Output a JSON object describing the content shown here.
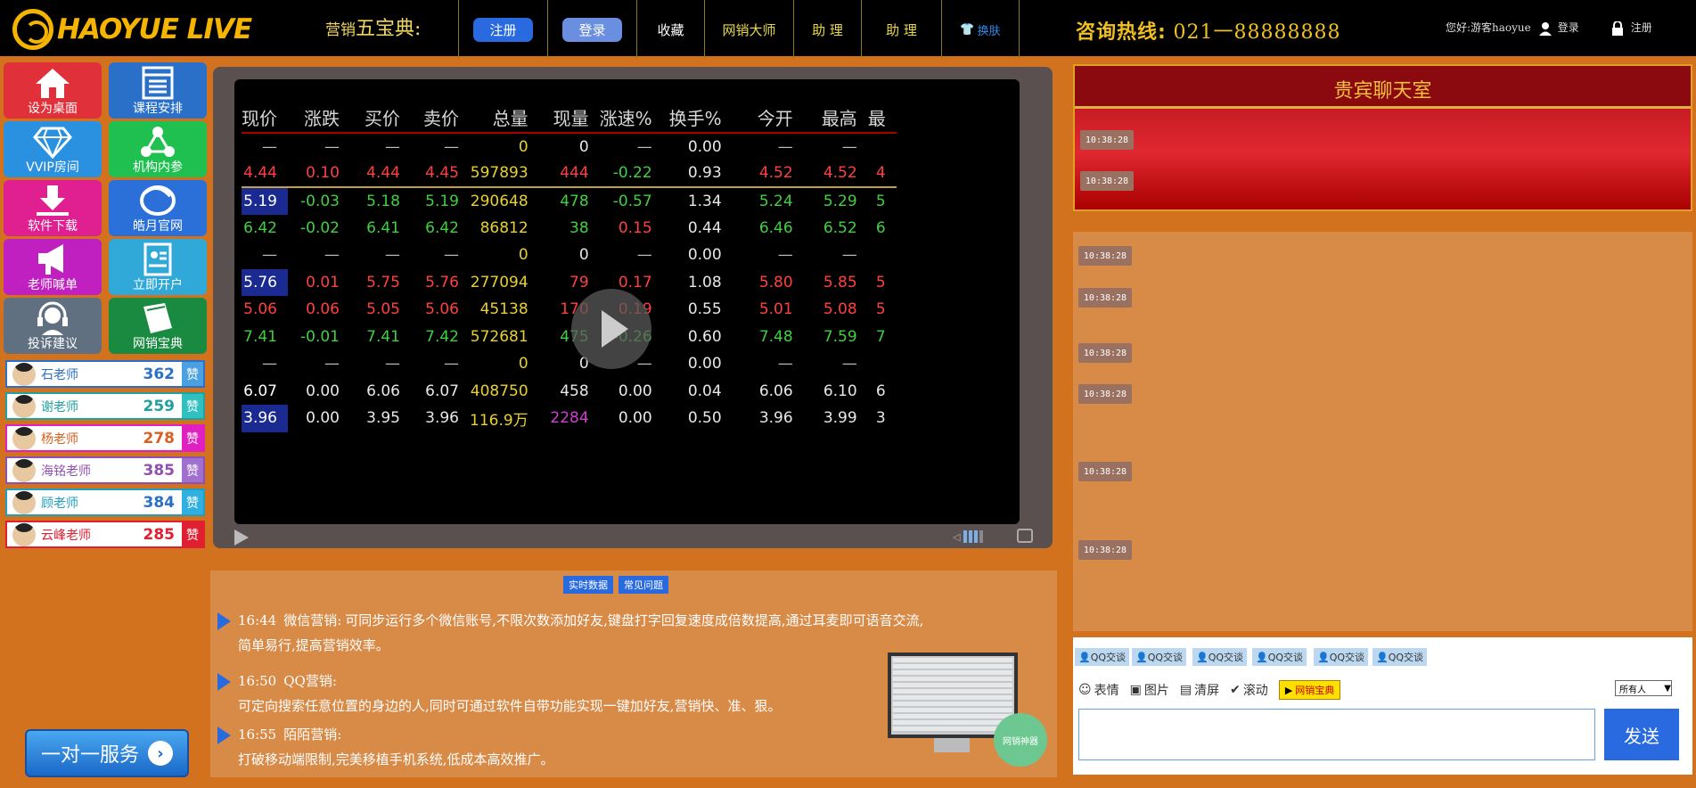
{
  "header": {
    "logo": "HAOYUE LIVE",
    "slogan_prefix": "营销",
    "slogan_main": "五宝典:",
    "register_btn": "注册",
    "login_btn": "登录",
    "nav": [
      "收藏",
      "网销大师",
      "助 理",
      "助 理",
      "换肤"
    ],
    "hotline_label": "咨询热线:",
    "hotline_number": "021一88888888",
    "greeting": "您好:游客haoyue",
    "user_login": "登录",
    "user_register": "注册"
  },
  "tiles": [
    {
      "label": "设为桌面",
      "icon": "home-icon",
      "color": "#e0303a"
    },
    {
      "label": "课程安排",
      "icon": "calendar-icon",
      "color": "#2a70c8"
    },
    {
      "label": "VVIP房间",
      "icon": "diamond-icon",
      "color": "#2a90e0"
    },
    {
      "label": "机构内参",
      "icon": "share-icon",
      "color": "#20c050"
    },
    {
      "label": "软件下载",
      "icon": "download-icon",
      "color": "#e02090"
    },
    {
      "label": "皓月官网",
      "icon": "logo-icon",
      "color": "#2a70d8"
    },
    {
      "label": "老师喊单",
      "icon": "megaphone-icon",
      "color": "#c020c0"
    },
    {
      "label": "立即开户",
      "icon": "id-card-icon",
      "color": "#30a8d8"
    },
    {
      "label": "投诉建议",
      "icon": "headset-icon",
      "color": "#607080"
    },
    {
      "label": "网销宝典",
      "icon": "book-icon",
      "color": "#1a8a40"
    }
  ],
  "teachers": [
    {
      "name": "石老师",
      "count": "362",
      "color": "#2a70c8",
      "zan": "赞"
    },
    {
      "name": "谢老师",
      "count": "259",
      "color": "#20a0a0",
      "zan": "赞"
    },
    {
      "name": "杨老师",
      "count": "278",
      "color": "#e020c0",
      "zan": "赞"
    },
    {
      "name": "海铭老师",
      "count": "385",
      "color": "#9050b0",
      "zan": "赞"
    },
    {
      "name": "顾老师",
      "count": "384",
      "color": "#20a0c0",
      "zan": "赞"
    },
    {
      "name": "云峰老师",
      "count": "285",
      "color": "#e02030",
      "zan": "赞"
    }
  ],
  "service_btn": "一对一服务",
  "stock_table": {
    "headers": [
      "现价",
      "涨跌",
      "买价",
      "卖价",
      "总量",
      "现量",
      "涨速%",
      "换手%",
      "今开",
      "最高",
      "最"
    ],
    "rows": [
      [
        "—",
        "—",
        "—",
        "—",
        "0",
        "0",
        "—",
        "0.00",
        "—",
        "—",
        ""
      ],
      [
        "4.44",
        "0.10",
        "4.44",
        "4.45",
        "597893",
        "444",
        "-0.22",
        "0.93",
        "4.52",
        "4.52",
        "4"
      ],
      [
        "5.19",
        "-0.03",
        "5.18",
        "5.19",
        "290648",
        "478",
        "-0.57",
        "1.34",
        "5.24",
        "5.29",
        "5"
      ],
      [
        "6.42",
        "-0.02",
        "6.41",
        "6.42",
        "86812",
        "38",
        "0.15",
        "0.44",
        "6.46",
        "6.52",
        "6"
      ],
      [
        "—",
        "—",
        "—",
        "—",
        "0",
        "0",
        "—",
        "0.00",
        "—",
        "—",
        ""
      ],
      [
        "5.76",
        "0.01",
        "5.75",
        "5.76",
        "277094",
        "79",
        "0.17",
        "1.08",
        "5.80",
        "5.85",
        "5"
      ],
      [
        "5.06",
        "0.06",
        "5.05",
        "5.06",
        "45138",
        "170",
        "0.19",
        "0.55",
        "5.01",
        "5.08",
        "5"
      ],
      [
        "7.41",
        "-0.01",
        "7.41",
        "7.42",
        "572681",
        "475",
        "-0.26",
        "0.60",
        "7.48",
        "7.59",
        "7"
      ],
      [
        "—",
        "—",
        "—",
        "—",
        "0",
        "0",
        "—",
        "0.00",
        "—",
        "—",
        ""
      ],
      [
        "6.07",
        "0.00",
        "6.06",
        "6.07",
        "408750",
        "458",
        "0.00",
        "0.04",
        "6.06",
        "6.10",
        "6"
      ],
      [
        "3.96",
        "0.00",
        "3.95",
        "3.96",
        "116.9万",
        "2284",
        "0.00",
        "0.50",
        "3.96",
        "3.99",
        "3"
      ]
    ]
  },
  "news": {
    "tabs": [
      "实时数据",
      "常见问题"
    ],
    "items": [
      {
        "time": "16:44",
        "title": "微信营销:",
        "text1": "可同步运行多个微信账号,不限次数添加好友,键盘打字回复速度成倍数提高,通过耳麦即可语音交流,",
        "text2": "简单易行,提高营销效率。"
      },
      {
        "time": "16:50",
        "title": "QQ营销:",
        "text1": "",
        "text2": "可定向搜索任意位置的身边的人,同时可通过软件自带功能实现一键加好友,营销快、准、狠。"
      },
      {
        "time": "16:55",
        "title": "陌陌营销:",
        "text1": "",
        "text2": "打破移动端限制,完美移植手机系统,低成本高效推广。"
      }
    ],
    "badge": "网销神器"
  },
  "vip_chat": {
    "title": "贵宾聊天室",
    "times": [
      "10:38:28",
      "10:38:28"
    ]
  },
  "chat_times": [
    "10:38:28",
    "10:38:28",
    "10:38:28",
    "10:38:28",
    "10:38:28",
    "10:38:28"
  ],
  "qq_buttons": [
    "QQ交谈",
    "QQ交谈",
    "QQ交谈",
    "QQ交谈",
    "QQ交谈",
    "QQ交谈"
  ],
  "tools": {
    "emoji": "表情",
    "image": "图片",
    "clear": "清屏",
    "scroll": "滚动",
    "wx": "网销宝典",
    "target": "所有人",
    "send": "发送"
  }
}
